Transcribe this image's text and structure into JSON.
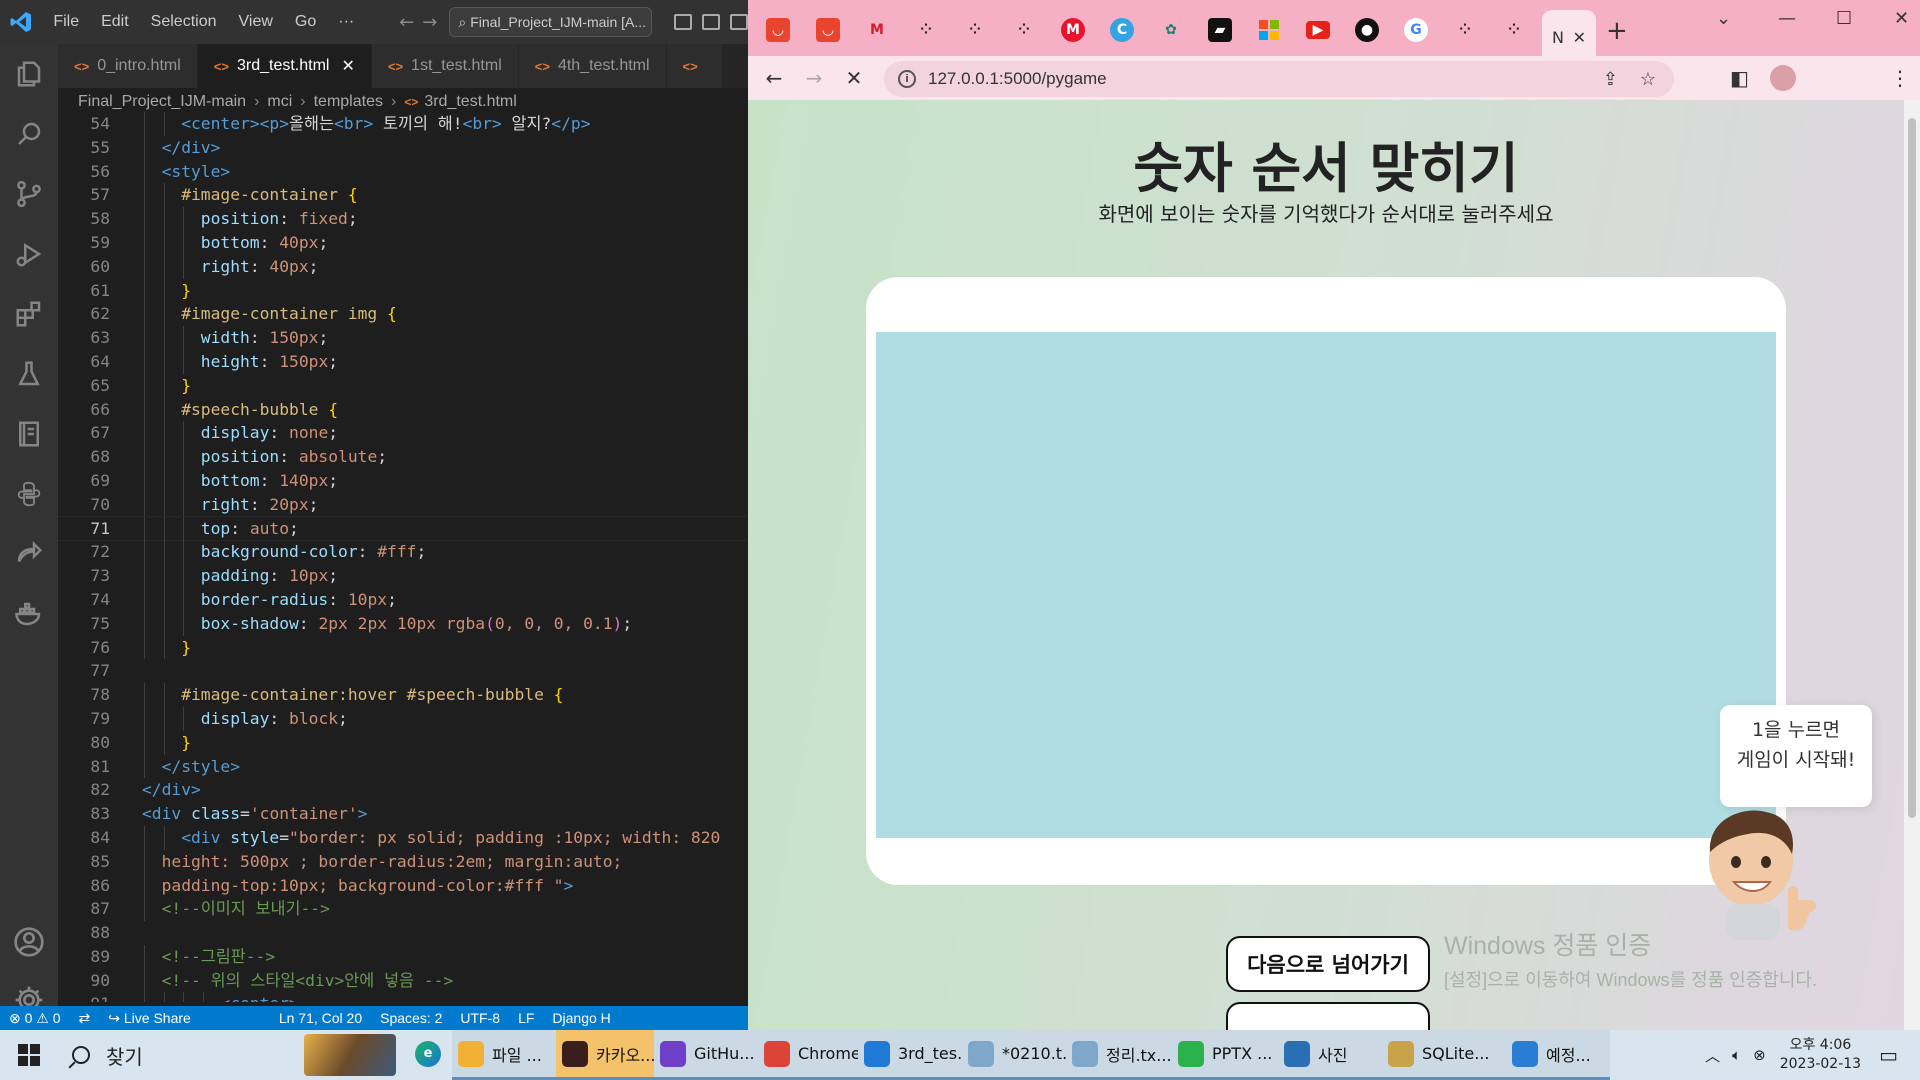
{
  "vscode": {
    "menu": [
      "File",
      "Edit",
      "Selection",
      "View",
      "Go",
      "···"
    ],
    "search": "Final_Project_IJM-main [A...",
    "tabs": [
      {
        "label": "0_intro.html",
        "active": false
      },
      {
        "label": "3rd_test.html",
        "active": true
      },
      {
        "label": "1st_test.html",
        "active": false
      },
      {
        "label": "4th_test.html",
        "active": false
      }
    ],
    "breadcrumb": [
      "Final_Project_IJM-main",
      "mci",
      "templates",
      "3rd_test.html"
    ],
    "code_lines": [
      {
        "n": "54",
        "indent": 2,
        "tokens": [
          [
            "t",
            "<center>"
          ],
          [
            "t",
            "<p>"
          ],
          [
            "x",
            "올해는"
          ],
          [
            "t",
            "<br>"
          ],
          [
            "x",
            " 토끼의 해!"
          ],
          [
            "t",
            "<br>"
          ],
          [
            "x",
            " 알지?"
          ],
          [
            "t",
            "</p>"
          ]
        ]
      },
      {
        "n": "55",
        "indent": 1,
        "tokens": [
          [
            "t",
            "</div>"
          ]
        ]
      },
      {
        "n": "56",
        "indent": 1,
        "tokens": [
          [
            "t",
            "<style>"
          ]
        ]
      },
      {
        "n": "57",
        "indent": 2,
        "tokens": [
          [
            "s",
            "#image-container "
          ],
          [
            "b",
            "{"
          ]
        ]
      },
      {
        "n": "58",
        "indent": 3,
        "tokens": [
          [
            "p",
            "position"
          ],
          [
            "x",
            ": "
          ],
          [
            "v",
            "fixed"
          ],
          [
            "x",
            ";"
          ]
        ]
      },
      {
        "n": "59",
        "indent": 3,
        "tokens": [
          [
            "p",
            "bottom"
          ],
          [
            "x",
            ": "
          ],
          [
            "v",
            "40px"
          ],
          [
            "x",
            ";"
          ]
        ]
      },
      {
        "n": "60",
        "indent": 3,
        "tokens": [
          [
            "p",
            "right"
          ],
          [
            "x",
            ": "
          ],
          [
            "v",
            "40px"
          ],
          [
            "x",
            ";"
          ]
        ]
      },
      {
        "n": "61",
        "indent": 2,
        "tokens": [
          [
            "b",
            "}"
          ]
        ]
      },
      {
        "n": "62",
        "indent": 2,
        "tokens": [
          [
            "s",
            "#image-container img "
          ],
          [
            "b",
            "{"
          ]
        ]
      },
      {
        "n": "63",
        "indent": 3,
        "tokens": [
          [
            "p",
            "width"
          ],
          [
            "x",
            ": "
          ],
          [
            "v",
            "150px"
          ],
          [
            "x",
            ";"
          ]
        ]
      },
      {
        "n": "64",
        "indent": 3,
        "tokens": [
          [
            "p",
            "height"
          ],
          [
            "x",
            ": "
          ],
          [
            "v",
            "150px"
          ],
          [
            "x",
            ";"
          ]
        ]
      },
      {
        "n": "65",
        "indent": 2,
        "tokens": [
          [
            "b",
            "}"
          ]
        ]
      },
      {
        "n": "66",
        "indent": 2,
        "tokens": [
          [
            "s",
            "#speech-bubble "
          ],
          [
            "b",
            "{"
          ]
        ]
      },
      {
        "n": "67",
        "indent": 3,
        "tokens": [
          [
            "p",
            "display"
          ],
          [
            "x",
            ": "
          ],
          [
            "v",
            "none"
          ],
          [
            "x",
            ";"
          ]
        ]
      },
      {
        "n": "68",
        "indent": 3,
        "tokens": [
          [
            "p",
            "position"
          ],
          [
            "x",
            ": "
          ],
          [
            "v",
            "absolute"
          ],
          [
            "x",
            ";"
          ]
        ]
      },
      {
        "n": "69",
        "indent": 3,
        "tokens": [
          [
            "p",
            "bottom"
          ],
          [
            "x",
            ": "
          ],
          [
            "v",
            "140px"
          ],
          [
            "x",
            ";"
          ]
        ]
      },
      {
        "n": "70",
        "indent": 3,
        "tokens": [
          [
            "p",
            "right"
          ],
          [
            "x",
            ": "
          ],
          [
            "v",
            "20px"
          ],
          [
            "x",
            ";"
          ]
        ]
      },
      {
        "n": "71",
        "indent": 3,
        "current": true,
        "tokens": [
          [
            "p",
            "top"
          ],
          [
            "x",
            ": "
          ],
          [
            "v",
            "auto"
          ],
          [
            "x",
            ";"
          ]
        ]
      },
      {
        "n": "72",
        "indent": 3,
        "tokens": [
          [
            "p",
            "background-color"
          ],
          [
            "x",
            ": "
          ],
          [
            "v",
            "#fff"
          ],
          [
            "x",
            ";"
          ]
        ]
      },
      {
        "n": "73",
        "indent": 3,
        "tokens": [
          [
            "p",
            "padding"
          ],
          [
            "x",
            ": "
          ],
          [
            "v",
            "10px"
          ],
          [
            "x",
            ";"
          ]
        ]
      },
      {
        "n": "74",
        "indent": 3,
        "tokens": [
          [
            "p",
            "border-radius"
          ],
          [
            "x",
            ": "
          ],
          [
            "v",
            "10px"
          ],
          [
            "x",
            ";"
          ]
        ]
      },
      {
        "n": "75",
        "indent": 3,
        "tokens": [
          [
            "p",
            "box-shadow"
          ],
          [
            "x",
            ": "
          ],
          [
            "v",
            "2px 2px 10px "
          ],
          [
            "v",
            "rgba"
          ],
          [
            "r",
            "("
          ],
          [
            "v",
            "0, 0, 0, 0.1"
          ],
          [
            "r",
            ")"
          ],
          [
            "x",
            ";"
          ]
        ]
      },
      {
        "n": "76",
        "indent": 2,
        "tokens": [
          [
            "b",
            "}"
          ]
        ]
      },
      {
        "n": "77",
        "indent": 0,
        "tokens": []
      },
      {
        "n": "78",
        "indent": 2,
        "tokens": [
          [
            "s",
            "#image-container:hover #speech-bubble "
          ],
          [
            "b",
            "{"
          ]
        ]
      },
      {
        "n": "79",
        "indent": 3,
        "tokens": [
          [
            "p",
            "display"
          ],
          [
            "x",
            ": "
          ],
          [
            "v",
            "block"
          ],
          [
            "x",
            ";"
          ]
        ]
      },
      {
        "n": "80",
        "indent": 2,
        "tokens": [
          [
            "b",
            "}"
          ]
        ]
      },
      {
        "n": "81",
        "indent": 1,
        "tokens": [
          [
            "t",
            "</style>"
          ]
        ]
      },
      {
        "n": "82",
        "indent": 0,
        "tokens": [
          [
            "t",
            "</div>"
          ]
        ]
      },
      {
        "n": "83",
        "indent": 0,
        "tokens": [
          [
            "t",
            "<div "
          ],
          [
            "p",
            "class"
          ],
          [
            "x",
            "="
          ],
          [
            "v",
            "'container'"
          ],
          [
            "t",
            ">"
          ]
        ]
      },
      {
        "n": "84",
        "indent": 2,
        "tokens": [
          [
            "t",
            "<div "
          ],
          [
            "p",
            "style"
          ],
          [
            "x",
            "="
          ],
          [
            "v",
            "\"border: px solid; padding :10px; width: 820"
          ]
        ]
      },
      {
        "n": "85",
        "indent": 1,
        "tokens": [
          [
            "v",
            "height: 500px ; border-radius:2em; margin:auto;"
          ]
        ]
      },
      {
        "n": "86",
        "indent": 1,
        "tokens": [
          [
            "v",
            "padding-top:10px; background-color:#fff \""
          ],
          [
            "t",
            ">"
          ]
        ]
      },
      {
        "n": "87",
        "indent": 1,
        "tokens": [
          [
            "c",
            "<!--이미지 보내기-->"
          ]
        ]
      },
      {
        "n": "88",
        "indent": 0,
        "tokens": []
      },
      {
        "n": "89",
        "indent": 1,
        "tokens": [
          [
            "c",
            "<!--그림판-->"
          ]
        ]
      },
      {
        "n": "90",
        "indent": 1,
        "tokens": [
          [
            "c",
            "<!-- 위의 스타일<div>안에 넣음 -->"
          ]
        ]
      },
      {
        "n": "91",
        "indent": 4,
        "tokens": [
          [
            "t",
            "<center>"
          ]
        ]
      }
    ],
    "status": {
      "problems": "⊗ 0 ⚠ 0",
      "live_share": "Live Share",
      "cursor": "Ln 71, Col 20",
      "spaces": "Spaces: 2",
      "encoding": "UTF-8",
      "eol": "LF",
      "language": "Django H"
    }
  },
  "chrome": {
    "url": "127.0.0.1:5000/pygame",
    "active_tab": "N",
    "page": {
      "title": "숫자 순서 맞히기",
      "subtitle": "화면에 보이는 숫자를 기억했다가 순서대로 눌러주세요",
      "bubble_line1": "1을 누르면",
      "bubble_line2": "게임이 시작돼!",
      "next_button": "다음으로 넘어가기",
      "watermark_title": "Windows 정품 인증",
      "watermark_sub": "[설정]으로 이동하여 Windows를 정품 인증합니다."
    },
    "colors": {
      "tabstrip": "#f5b0c5",
      "canvas": "#b0dde3"
    }
  },
  "taskbar": {
    "search": "찾기",
    "apps": [
      {
        "label": "파일 ...",
        "icon": "folder-icon",
        "color": "#f2b035"
      },
      {
        "label": "카카오...",
        "icon": "kakaotalk-icon",
        "color": "#3a1d1d"
      },
      {
        "label": "GitHu...",
        "icon": "github-desktop-icon",
        "color": "#6e40c9"
      },
      {
        "label": "Chrome",
        "icon": "chrome-icon",
        "color": "#db4437"
      },
      {
        "label": "3rd_tes...",
        "icon": "vscode-icon",
        "color": "#1f7ad6"
      },
      {
        "label": "*0210.t...",
        "icon": "notepad-icon",
        "color": "#7fa7c9"
      },
      {
        "label": "정리.tx...",
        "icon": "notepad-icon",
        "color": "#7fa7c9"
      },
      {
        "label": "PPTX ...",
        "icon": "pptx-icon",
        "color": "#2bb24c"
      },
      {
        "label": "사진",
        "icon": "photos-icon",
        "color": "#2a6fb5"
      },
      {
        "label": "SQLite...",
        "icon": "sqlite-icon",
        "color": "#c8a34a"
      },
      {
        "label": "예정...",
        "icon": "document-icon",
        "color": "#2b7cd3"
      }
    ],
    "time": "오후 4:06",
    "date": "2023-02-13"
  }
}
